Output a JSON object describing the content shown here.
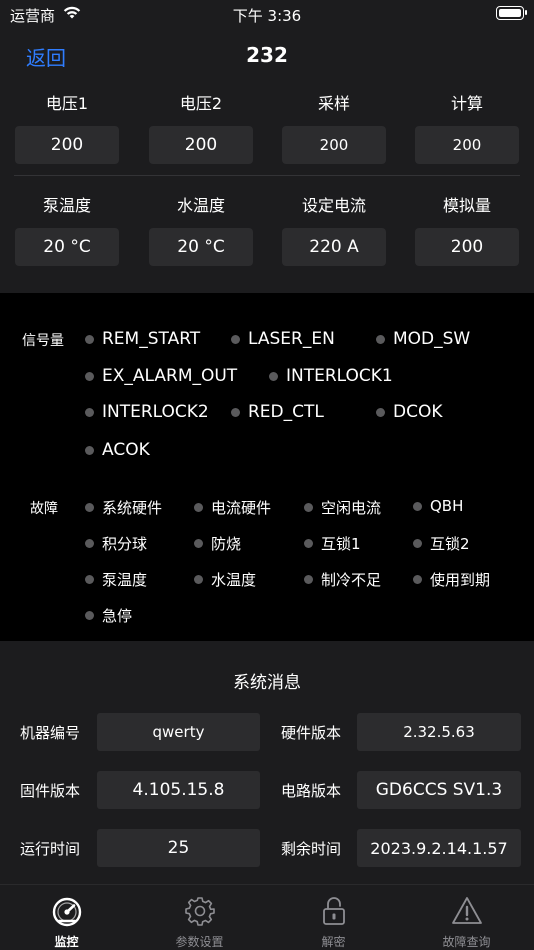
{
  "status": {
    "carrier": "运营商",
    "time": "下午 3:36"
  },
  "nav": {
    "back": "返回",
    "title": "232"
  },
  "metrics_row1": [
    {
      "label": "电压1",
      "value": "200"
    },
    {
      "label": "电压2",
      "value": "200"
    },
    {
      "label": "采样",
      "value": "200"
    },
    {
      "label": "计算",
      "value": "200"
    }
  ],
  "metrics_row2": [
    {
      "label": "泵温度",
      "value": "20 °C"
    },
    {
      "label": "水温度",
      "value": "20 °C"
    },
    {
      "label": "设定电流",
      "value": "220 A"
    },
    {
      "label": "模拟量",
      "value": "200"
    }
  ],
  "signals": {
    "label": "信号量",
    "items": [
      "REM_START",
      "LASER_EN",
      "MOD_SW",
      "EX_ALARM_OUT",
      "INTERLOCK1",
      "INTERLOCK2",
      "RED_CTL",
      "DCOK",
      "ACOK"
    ]
  },
  "faults": {
    "label": "故障",
    "items": [
      "系统硬件",
      "电流硬件",
      "空闲电流",
      "QBH",
      "积分球",
      "防烧",
      "互锁1",
      "互锁2",
      "泵温度",
      "水温度",
      "制冷不足",
      "使用到期",
      "急停"
    ]
  },
  "system": {
    "title": "系统消息",
    "rows": [
      {
        "label1": "机器编号",
        "value1": "qwerty",
        "label2": "硬件版本",
        "value2": "2.32.5.63"
      },
      {
        "label1": "固件版本",
        "value1": "4.105.15.8",
        "label2": "电路版本",
        "value2": "GD6CCS SV1.3"
      },
      {
        "label1": "运行时间",
        "value1": "25",
        "label2": "剩余时间",
        "value2": "2023.9.2.14.1.57"
      }
    ]
  },
  "tabs": [
    {
      "label": "监控",
      "icon": "gauge-icon",
      "active": true
    },
    {
      "label": "参数设置",
      "icon": "gear-icon",
      "active": false
    },
    {
      "label": "解密",
      "icon": "lock-icon",
      "active": false
    },
    {
      "label": "故障查询",
      "icon": "warning-icon",
      "active": false
    }
  ]
}
